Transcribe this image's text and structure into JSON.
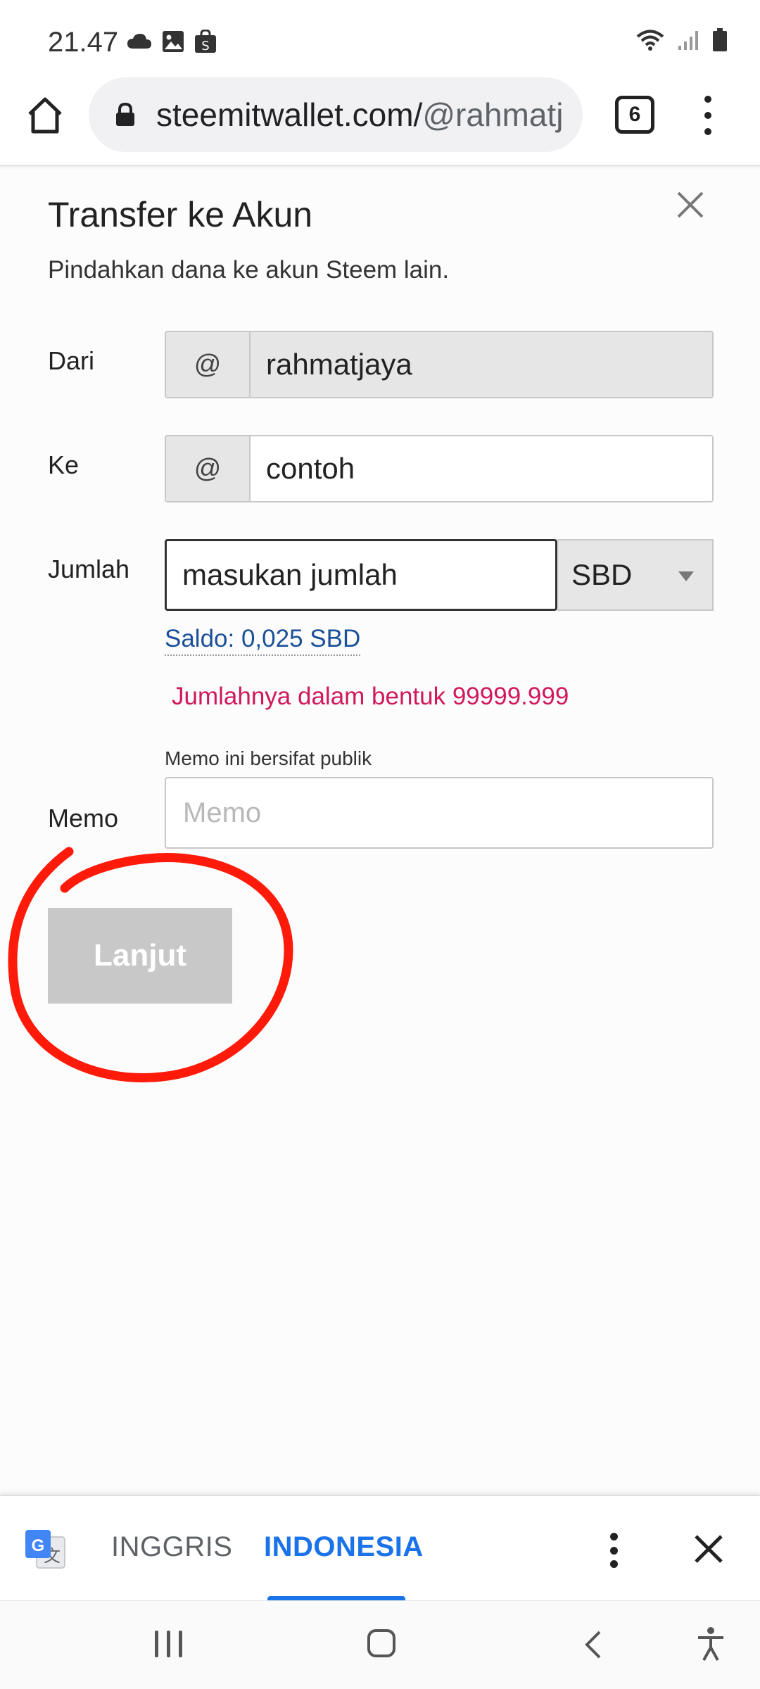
{
  "status_bar": {
    "time": "21.47"
  },
  "browser": {
    "url_domain": "steemitwallet.com/",
    "url_path": "@rahmatj",
    "tab_count": "6"
  },
  "modal": {
    "title": "Transfer ke Akun",
    "subtitle": "Pindahkan dana ke akun Steem lain.",
    "from_label": "Dari",
    "from_prefix": "@",
    "from_value": "rahmatjaya",
    "to_label": "Ke",
    "to_prefix": "@",
    "to_value": "contoh",
    "amount_label": "Jumlah",
    "amount_value": "masukan jumlah",
    "asset_selected": "SBD",
    "balance": "Saldo: 0,025 SBD",
    "amount_error": "Jumlahnya dalam bentuk 99999.999",
    "memo_hint": "Memo ini bersifat publik",
    "memo_label": "Memo",
    "memo_placeholder": "Memo",
    "next_button": "Lanjut"
  },
  "translate_bar": {
    "source_language": "INGGRIS",
    "target_language": "INDONESIA"
  },
  "colors": {
    "accent_blue": "#1a73e8",
    "link_blue": "#1a5099",
    "error_pink": "#d0185a",
    "annotation_red": "#ff1a0a",
    "disabled_button": "#c8c8c8"
  }
}
